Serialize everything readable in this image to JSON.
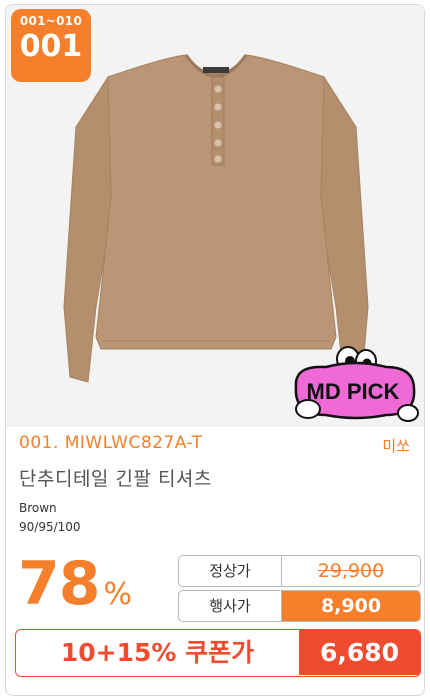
{
  "badge": {
    "range": "001~010",
    "rank": "001"
  },
  "product": {
    "code_line": "001. MIWLWC827A-T",
    "brand": "미쏘",
    "name": "단추디테일 긴팔 티셔츠",
    "color": "Brown",
    "sizes": "90/95/100",
    "image_color": "#b89676"
  },
  "sticker": {
    "text": "MD PICK",
    "color": "#ef6ad6"
  },
  "pricing": {
    "discount_number": "78",
    "discount_sign": "%",
    "regular_label": "정상가",
    "regular_price": "29,900",
    "sale_label": "행사가",
    "sale_price": "8,900",
    "coupon_label": "10+15% 쿠폰가",
    "coupon_price": "6,680"
  },
  "colors": {
    "accent": "#f57f2a",
    "coupon": "#f04a2f"
  }
}
